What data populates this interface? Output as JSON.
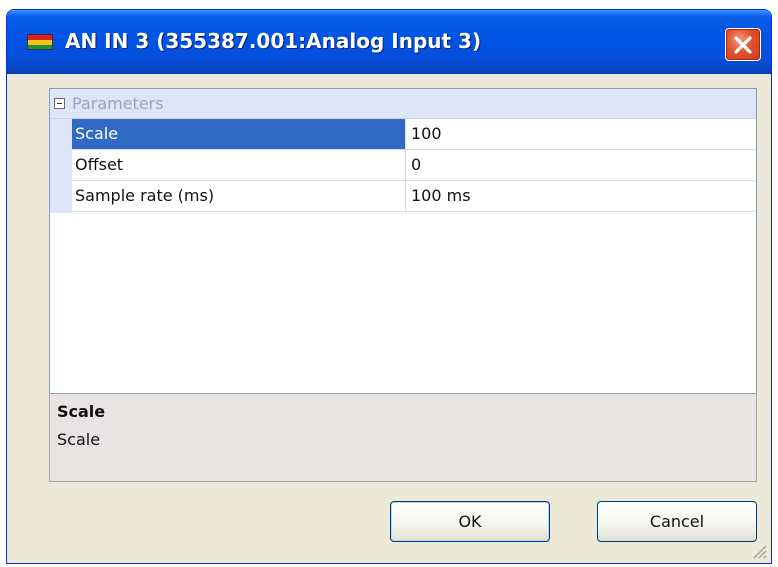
{
  "window": {
    "title": "AN IN 3 (355387.001:Analog Input 3)",
    "icon": "module-icon",
    "close_icon": "close-icon"
  },
  "grid": {
    "category": "Parameters",
    "category_state": "expanded",
    "properties": [
      {
        "name": "Scale",
        "value": "100",
        "selected": true
      },
      {
        "name": "Offset",
        "value": "0",
        "selected": false
      },
      {
        "name": "Sample rate (ms)",
        "value": "100 ms",
        "selected": false
      }
    ]
  },
  "help": {
    "title": "Scale",
    "description": "Scale"
  },
  "buttons": {
    "ok": "OK",
    "cancel": "Cancel"
  },
  "colors": {
    "titlebar": "#0055e5",
    "selection": "#316ac5",
    "close": "#e2512f"
  }
}
